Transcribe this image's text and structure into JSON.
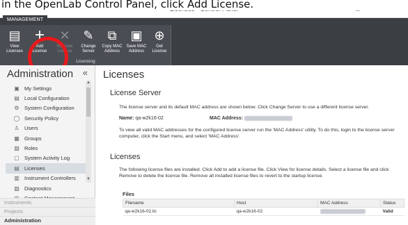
{
  "caption": "in the OpenLab Control Panel, click Add License.",
  "window": {
    "title": "Licenses - Control Panel",
    "controls": [
      "⎙",
      "?",
      "−",
      "□",
      "×"
    ]
  },
  "ribbon": {
    "tab": "MANAGEMENT",
    "group_label": "Licensing",
    "buttons": [
      {
        "label": "View Licenses",
        "icon": "view-license-icon",
        "glyph": "▤",
        "enabled": true
      },
      {
        "label": "Add License",
        "icon": "plus-icon",
        "glyph": "+",
        "enabled": true
      },
      {
        "label": "Remove License",
        "icon": "remove-icon",
        "glyph": "✕",
        "enabled": false
      },
      {
        "label": "Change Server",
        "icon": "pencil-icon",
        "glyph": "✎",
        "enabled": true
      },
      {
        "label": "Copy MAC Address",
        "icon": "copy-icon",
        "glyph": "⧉",
        "enabled": true
      },
      {
        "label": "Save MAC Address",
        "icon": "save-icon",
        "glyph": "▣",
        "enabled": true
      },
      {
        "label": "Get License",
        "icon": "globe-icon",
        "glyph": "⊕",
        "enabled": true
      }
    ]
  },
  "sidebar": {
    "title": "Administration",
    "collapse": "«",
    "items": [
      {
        "label": "My Settings",
        "icon": "settings-icon",
        "glyph": "▣",
        "active": false
      },
      {
        "label": "Local Configuration",
        "icon": "local-config-icon",
        "glyph": "▤",
        "active": false
      },
      {
        "label": "System Configuration",
        "icon": "gear-icon",
        "glyph": "⚙",
        "active": false
      },
      {
        "label": "Security Policy",
        "icon": "shield-icon",
        "glyph": "◯",
        "active": false
      },
      {
        "label": "Users",
        "icon": "user-icon",
        "glyph": "♙",
        "active": false
      },
      {
        "label": "Groups",
        "icon": "groups-icon",
        "glyph": "▦",
        "active": false
      },
      {
        "label": "Roles",
        "icon": "roles-icon",
        "glyph": "▧",
        "active": false
      },
      {
        "label": "System Activity Log",
        "icon": "log-icon",
        "glyph": "▢",
        "active": false
      },
      {
        "label": "Licenses",
        "icon": "license-icon",
        "glyph": "▤",
        "active": true
      },
      {
        "label": "Instrument Controllers",
        "icon": "instrument-icon",
        "glyph": "▥",
        "active": false
      },
      {
        "label": "Diagnostics",
        "icon": "diagnostics-icon",
        "glyph": "▨",
        "active": false
      },
      {
        "label": "Content Management",
        "icon": "content-icon",
        "glyph": "⊞",
        "active": false
      }
    ],
    "sections": [
      "Instruments",
      "Projects",
      "Administration"
    ]
  },
  "main": {
    "title": "Licenses",
    "server": {
      "heading": "License Server",
      "desc": "The license server and its default MAC address are shown below. Click Change Server to use a different license server.",
      "name_label": "Name:",
      "name_value": "qa-w2k16-02",
      "mac_label": "MAC Address:",
      "mac_value": "00-50-56-A8-3C-9D",
      "note": "To view all valid MAC addresses for the configured license server run the 'MAC Address' utility. To do this, login to the license server computer, click the Start menu, and select 'MAC Address'."
    },
    "licenses": {
      "heading": "Licenses",
      "desc": "The following license files are installed. Click Add to add a license file. Click View for license details. Select a license file and click Remove to delete the license file. Remove all installed license files to revert to the startup license.",
      "files_label": "Files",
      "columns": [
        "Filename",
        "Host",
        "MAC Address",
        "Status"
      ],
      "rows": [
        [
          "qa-w2k16-02.lic",
          "qa-w2k16-02",
          "00-50-56-A8-3C-9D",
          "Valid"
        ]
      ]
    }
  }
}
